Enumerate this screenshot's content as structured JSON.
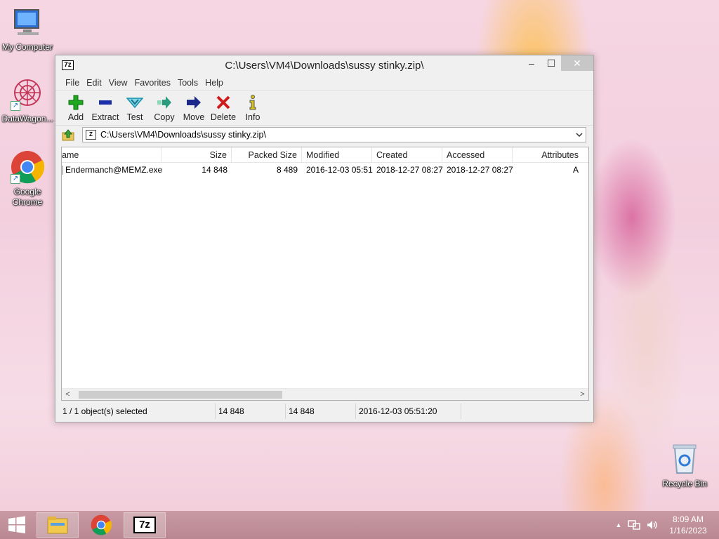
{
  "desktop": {
    "icons": [
      {
        "label": "My Computer",
        "icon": "computer-icon"
      },
      {
        "label": "DataWagon...",
        "icon": "datawagon-icon"
      },
      {
        "label": "Google Chrome",
        "icon": "chrome-icon"
      },
      {
        "label": "Recycle Bin",
        "icon": "recycle-bin-icon"
      }
    ]
  },
  "window": {
    "app_icon": "7z",
    "title": "C:\\Users\\VM4\\Downloads\\sussy stinky.zip\\",
    "controls": {
      "minimize": "–",
      "maximize": "☐",
      "close": "✕"
    },
    "menu": [
      "File",
      "Edit",
      "View",
      "Favorites",
      "Tools",
      "Help"
    ],
    "toolbar": [
      {
        "label": "Add",
        "icon": "add-icon",
        "color": "#1fa81f"
      },
      {
        "label": "Extract",
        "icon": "extract-icon",
        "color": "#1b2fa8"
      },
      {
        "label": "Test",
        "icon": "test-icon",
        "color": "#29b1c8"
      },
      {
        "label": "Copy",
        "icon": "copy-icon",
        "color": "#2a9c7d"
      },
      {
        "label": "Move",
        "icon": "move-icon",
        "color": "#1b2a8a"
      },
      {
        "label": "Delete",
        "icon": "delete-icon",
        "color": "#d01b1b"
      },
      {
        "label": "Info",
        "icon": "info-icon",
        "color": "#d8c21a"
      }
    ],
    "address": {
      "path": "C:\\Users\\VM4\\Downloads\\sussy stinky.zip\\",
      "zip_icon": "Z"
    },
    "columns": [
      "ame",
      "Size",
      "Packed Size",
      "Modified",
      "Created",
      "Accessed",
      "Attributes"
    ],
    "rows": [
      {
        "name": "Endermanch@MEMZ.exe",
        "size": "14 848",
        "packed": "8 489",
        "modified": "2016-12-03 05:51",
        "created": "2018-12-27 08:27",
        "accessed": "2018-12-27 08:27",
        "attributes": "A"
      }
    ],
    "scroll": {
      "left": "<",
      "right": ">"
    },
    "status": {
      "selected": "1 / 1 object(s) selected",
      "size": "14 848",
      "packed": "14 848",
      "modified": "2016-12-03 05:51:20"
    }
  },
  "taskbar": {
    "apps": [
      "file-explorer-icon",
      "chrome-icon",
      "7zip-icon"
    ],
    "seven_zip_label": "7z",
    "clock": {
      "time": "8:09 AM",
      "date": "1/16/2023"
    },
    "tray_arrow": "▲"
  }
}
